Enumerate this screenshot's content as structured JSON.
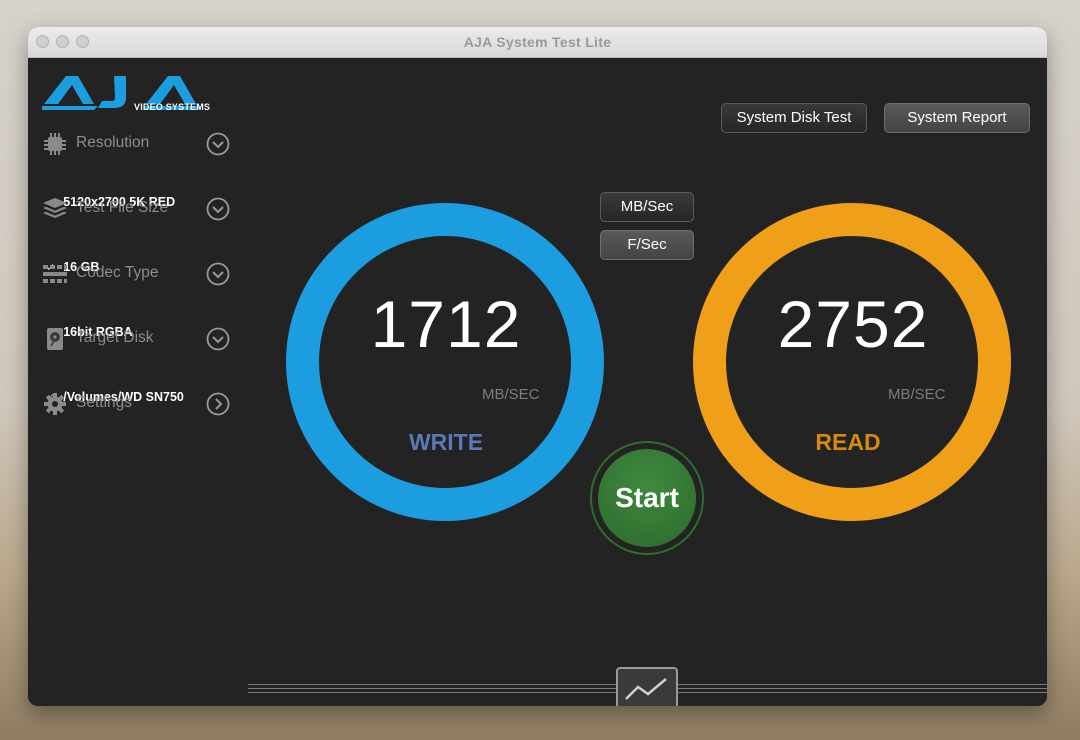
{
  "window": {
    "title": "AJA System Test Lite"
  },
  "logo": {
    "subtitle": "VIDEO SYSTEMS"
  },
  "sidebar": {
    "items": [
      {
        "label": "Resolution",
        "value": "5120x2700 5K RED"
      },
      {
        "label": "Test File Size",
        "value": "16 GB"
      },
      {
        "label": "Codec Type",
        "value": "16bit RGBA"
      },
      {
        "label": "Target Disk",
        "value": "/Volumes/WD SN750"
      },
      {
        "label": "Settings"
      }
    ]
  },
  "toolbar": {
    "disk_test_label": "System Disk Test",
    "report_label": "System Report"
  },
  "units": {
    "mbsec_label": "MB/Sec",
    "fsec_label": "F/Sec"
  },
  "write": {
    "value": "1712",
    "unit": "MB/SEC",
    "label": "WRITE",
    "color": "#1b9de0"
  },
  "read": {
    "value": "2752",
    "unit": "MB/SEC",
    "label": "READ",
    "color": "#f0a018"
  },
  "start": {
    "label": "Start"
  },
  "icons": [
    "resolution-chip-icon",
    "file-stack-icon",
    "codec-grid-icon",
    "hard-disk-icon",
    "gear-icon",
    "chevron-down-icon",
    "chevron-right-icon",
    "graph-monitor-icon"
  ]
}
